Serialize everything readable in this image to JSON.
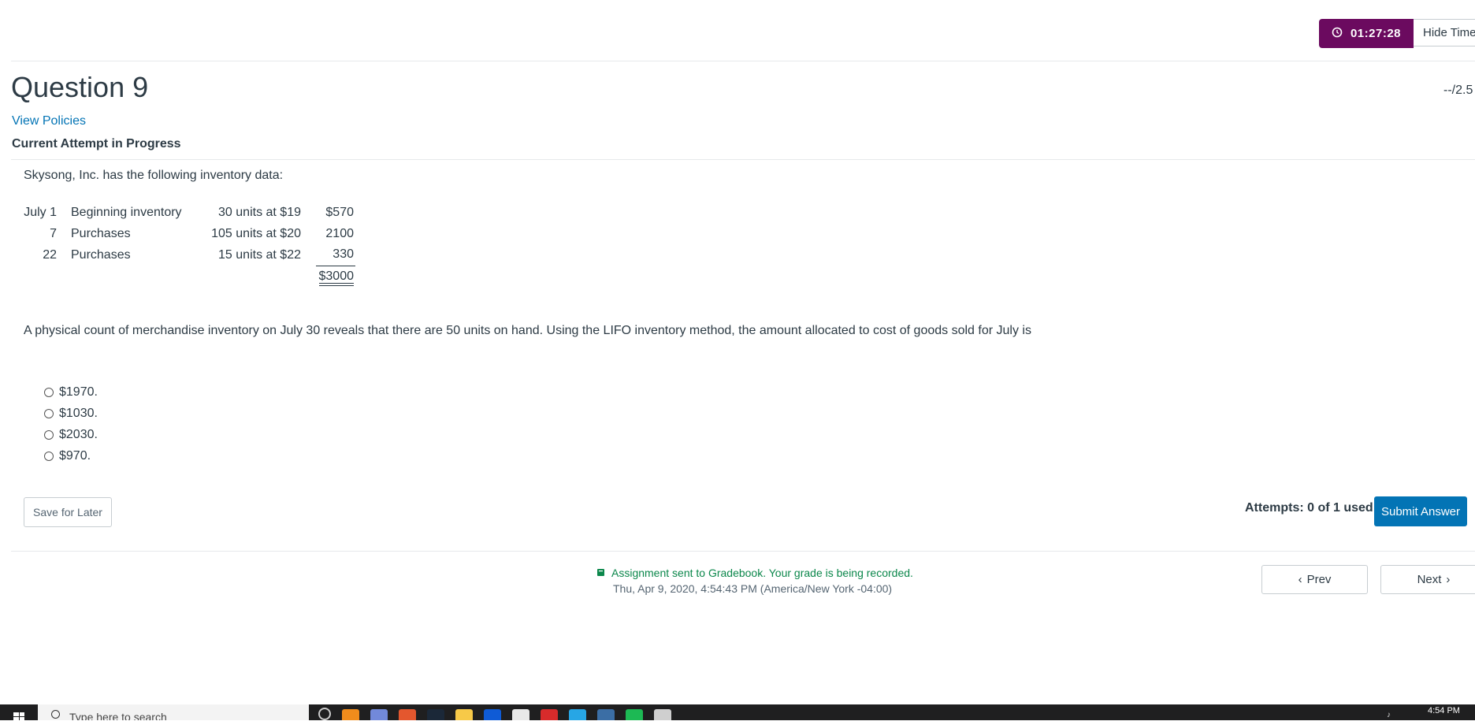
{
  "timer": {
    "value": "01:27:28",
    "hide_label": "Hide Timer"
  },
  "question": {
    "title": "Question 9",
    "points": "--/2.5",
    "view_policies": "View Policies",
    "attempt_status": "Current Attempt in Progress",
    "intro": "Skysong, Inc. has the following inventory data:",
    "inventory": [
      {
        "date": "July 1",
        "description": "Beginning inventory",
        "units": "30 units at $19",
        "amount": "$570"
      },
      {
        "date": "7",
        "description": "Purchases",
        "units": "105 units at $20",
        "amount": "2100"
      },
      {
        "date": "22",
        "description": "Purchases",
        "units": "15 units at $22",
        "amount": "330"
      }
    ],
    "inventory_total": "$3000",
    "problem_text": "A physical count of merchandise inventory on July 30 reveals that there are 50 units on hand. Using the LIFO inventory method, the amount allocated to cost of goods sold for July is",
    "choices": [
      "$1970.",
      "$1030.",
      "$2030.",
      "$970."
    ]
  },
  "actions": {
    "save_later": "Save for Later",
    "attempts": "Attempts: 0 of 1 used",
    "submit": "Submit Answer"
  },
  "gradebook": {
    "message": "Assignment sent to Gradebook. Your grade is being recorded.",
    "timestamp": "Thu, Apr 9, 2020, 4:54:43 PM (America/New York -04:00)"
  },
  "navigation": {
    "prev": "Prev",
    "next": "Next"
  },
  "taskbar": {
    "search_placeholder": "Type here to search",
    "clock": "4:54 PM",
    "icons": [
      "search-icon",
      "vlc-icon",
      "discord-icon",
      "browser-icon",
      "steam-icon",
      "file-explorer-icon",
      "x-app-icon",
      "mail-icon",
      "red-app-icon",
      "blue-app-icon",
      "steam-app-icon",
      "spotify-icon",
      "settings-icon"
    ],
    "colors": {
      "accent": "#0374b5",
      "timer": "#6b0a5f",
      "success": "#0b874b"
    }
  }
}
